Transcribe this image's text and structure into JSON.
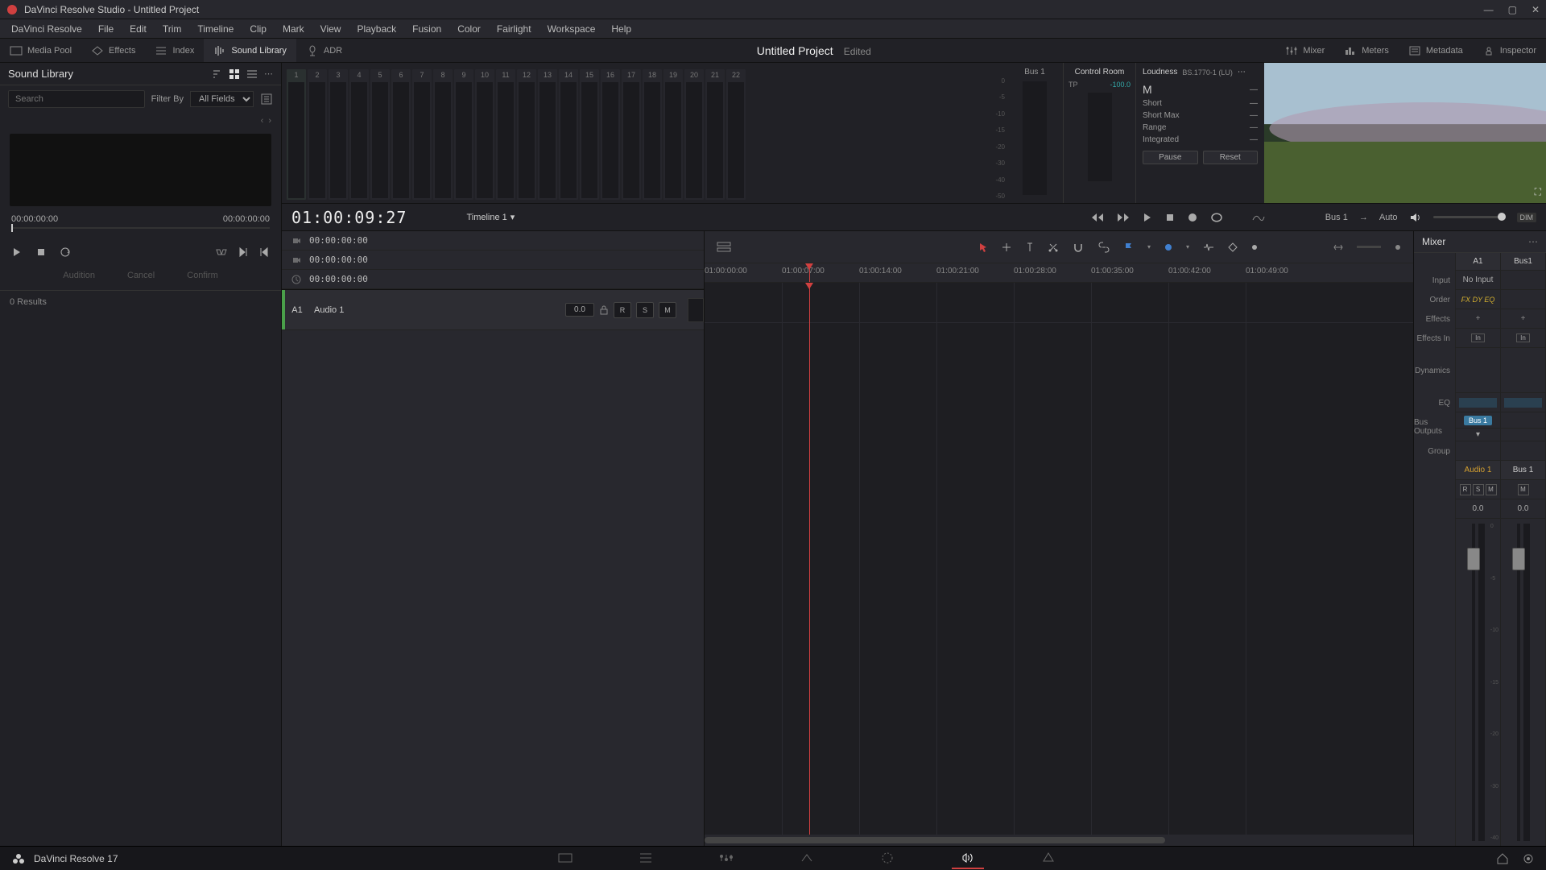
{
  "titlebar": {
    "title": "DaVinci Resolve Studio - Untitled Project"
  },
  "menu": [
    "DaVinci Resolve",
    "File",
    "Edit",
    "Trim",
    "Timeline",
    "Clip",
    "Mark",
    "View",
    "Playback",
    "Fusion",
    "Color",
    "Fairlight",
    "Workspace",
    "Help"
  ],
  "toolbar": {
    "media_pool": "Media Pool",
    "effects": "Effects",
    "index": "Index",
    "sound_library": "Sound Library",
    "adr": "ADR",
    "project": "Untitled Project",
    "edited": "Edited",
    "mixer": "Mixer",
    "meters": "Meters",
    "metadata": "Metadata",
    "inspector": "Inspector"
  },
  "library": {
    "title": "Sound Library",
    "search_placeholder": "Search",
    "filter_by": "Filter By",
    "all_fields": "All Fields",
    "tc_start": "00:00:00:00",
    "tc_end": "00:00:00:00",
    "audition": "Audition",
    "cancel": "Cancel",
    "confirm": "Confirm",
    "results": "0 Results"
  },
  "meters": {
    "bus": "Bus 1",
    "control_room": "Control Room",
    "tp_label": "TP",
    "tp_value": "-100.0",
    "m_label": "M",
    "loudness": "Loudness",
    "standard": "BS.1770-1 (LU)",
    "short": "Short",
    "short_max": "Short Max",
    "range": "Range",
    "integrated": "Integrated",
    "pause": "Pause",
    "reset": "Reset",
    "scale": [
      "0",
      "-5",
      "-10",
      "-15",
      "-20",
      "-30",
      "-40",
      "-50"
    ]
  },
  "transport": {
    "timecode": "01:00:09:27",
    "timeline": "Timeline 1",
    "bus": "Bus 1",
    "auto": "Auto",
    "dim": "DIM"
  },
  "subtc": {
    "tc1": "00:00:00:00",
    "tc2": "00:00:00:00",
    "tc3": "00:00:00:00"
  },
  "ruler": [
    "01:00:00:00",
    "01:00:07:00",
    "01:00:14:00",
    "01:00:21:00",
    "01:00:28:00",
    "01:00:35:00",
    "01:00:42:00",
    "01:00:49:00"
  ],
  "track": {
    "index": "A1",
    "name": "Audio 1",
    "vol": "0.0",
    "r": "R",
    "s": "S",
    "m": "M"
  },
  "mixer": {
    "title": "Mixer",
    "labels": {
      "input": "Input",
      "order": "Order",
      "effects": "Effects",
      "effects_in": "Effects In",
      "dynamics": "Dynamics",
      "eq": "EQ",
      "bus_outputs": "Bus Outputs",
      "group": "Group"
    },
    "a1": {
      "head": "A1",
      "input": "No Input",
      "order": "FX  DY  EQ",
      "name": "Audio 1",
      "vol": "0.0",
      "bus": "Bus 1"
    },
    "bus1": {
      "head": "Bus1",
      "name": "Bus 1",
      "vol": "0.0"
    },
    "rsm": [
      "R",
      "S",
      "M"
    ],
    "m": "M",
    "fader_ticks": [
      "0",
      "-5",
      "-10",
      "-15",
      "-20",
      "-30",
      "-40"
    ]
  },
  "bottom": {
    "version": "DaVinci Resolve 17"
  }
}
